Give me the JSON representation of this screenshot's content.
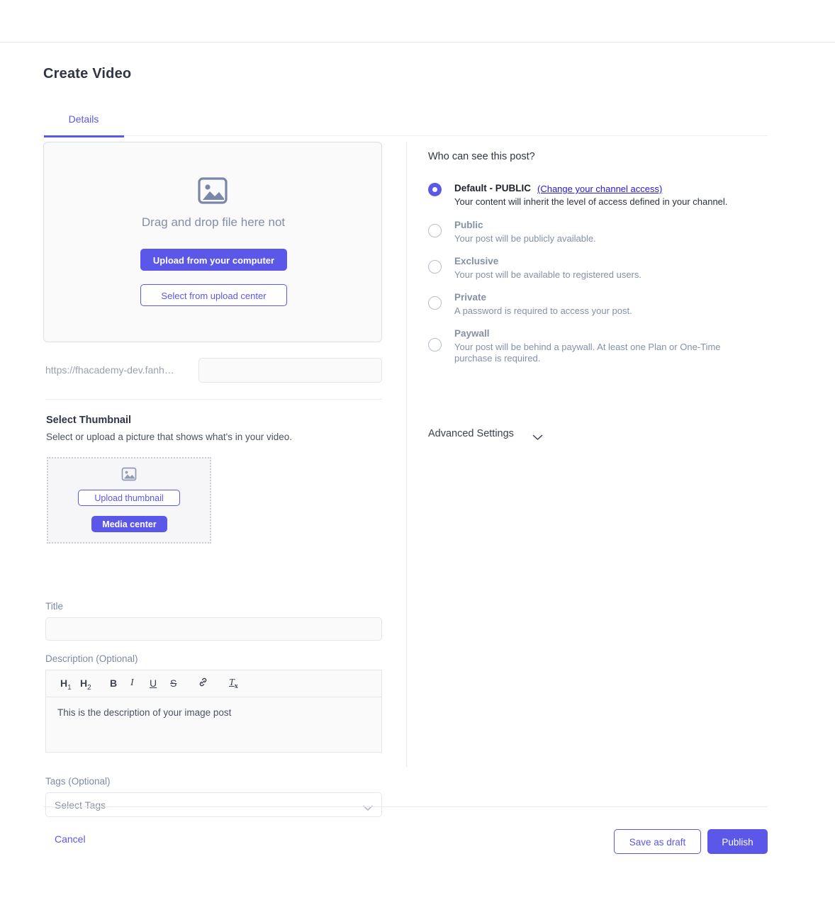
{
  "theme": {
    "accent": "#5b57e8",
    "link": "#2218e0",
    "muted": "#8490a8",
    "text": "#2f3542",
    "border": "#e4e6eb"
  },
  "header": {
    "page_title": "Create Video"
  },
  "tabs": [
    {
      "label": "Details",
      "active": true
    }
  ],
  "upload": {
    "dropzone_text": "Drag and drop file here not",
    "upload_button": "Upload from your computer",
    "select_button": "Select from upload center",
    "url_prefix": "https://fhacademy-dev.fanh…",
    "url_value": "",
    "url_placeholder": ""
  },
  "thumbnail": {
    "section_title": "Select Thumbnail",
    "section_subtitle": "Select or upload a picture that shows what's in your video.",
    "upload_button": "Upload thumbnail",
    "media_center_button": "Media center"
  },
  "title_field": {
    "label": "Title",
    "value": "",
    "placeholder": ""
  },
  "description": {
    "label": "Description (Optional)",
    "toolbar": [
      {
        "name": "heading-1",
        "label": "H",
        "sub": "1"
      },
      {
        "name": "heading-2",
        "label": "H",
        "sub": "2"
      },
      {
        "name": "bold",
        "label": "B",
        "sub": ""
      },
      {
        "name": "italic",
        "label": "I",
        "sub": ""
      },
      {
        "name": "underline",
        "label": "U",
        "sub": ""
      },
      {
        "name": "strikethrough",
        "label": "S",
        "sub": ""
      },
      {
        "name": "link",
        "label": "🔗",
        "sub": ""
      },
      {
        "name": "clear-formatting",
        "label": "T",
        "sub": "x"
      }
    ],
    "body_text": "This is the description of your image post"
  },
  "tags": {
    "label": "Tags (Optional)",
    "placeholder": "Select Tags",
    "value": ""
  },
  "visibility": {
    "title": "Who can see this post?",
    "options": [
      {
        "name": "Default - PUBLIC",
        "link": "(Change your channel access)",
        "description": "Your content will inherit the level of access defined in your channel.",
        "selected": true
      },
      {
        "name": "Public",
        "link": "",
        "description": "Your post will be publicly available.",
        "selected": false
      },
      {
        "name": "Exclusive",
        "link": "",
        "description": "Your post will be available to registered users.",
        "selected": false
      },
      {
        "name": "Private",
        "link": "",
        "description": "A password is required to access your post.",
        "selected": false
      },
      {
        "name": "Paywall",
        "link": "",
        "description": "Your post will be behind a paywall. At least one Plan or One-Time purchase is required.",
        "selected": false
      }
    ],
    "advanced_settings": "Advanced Settings"
  },
  "footer": {
    "cancel": "Cancel",
    "save_draft": "Save as draft",
    "publish": "Publish"
  }
}
